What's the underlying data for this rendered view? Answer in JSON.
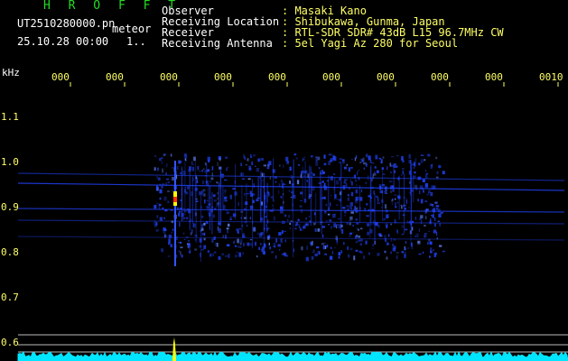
{
  "header": {
    "app_title": "H R O F F T",
    "filename": "UT2510280000.pn",
    "mode_label": "meteor",
    "datetime": "25.10.28 00:00",
    "counter": "1..",
    "info_labels": {
      "observer": "Observer",
      "location": "Receiving Location",
      "receiver": "Receiver",
      "antenna": "Receiving Antenna"
    },
    "info_values": {
      "observer": ": Masaki Kano",
      "location": ": Shibukawa, Gunma, Japan",
      "receiver": ": RTL-SDR SDR# 43dB L15 96.7MHz CW",
      "antenna": ": 5el Yagi Az 280 for Seoul"
    }
  },
  "axis": {
    "y_unit": "kHz",
    "y_ticks": [
      "1.1",
      "1.0",
      "0.9",
      "0.8",
      "0.7",
      "0.6"
    ],
    "x_ticks": [
      "000",
      "000",
      "000",
      "000",
      "000",
      "000",
      "000",
      "000",
      "000",
      "0010"
    ]
  },
  "colors": {
    "background": "#000000",
    "label_text": "#ffffff",
    "value_text": "#ffff66",
    "title_green": "#22dd22",
    "signal_blue": "#2244ff",
    "baseline_cyan": "#00e5ff"
  }
}
